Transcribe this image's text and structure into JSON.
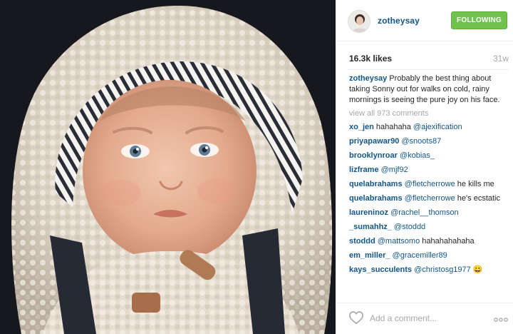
{
  "post": {
    "username": "zotheysay",
    "follow_label": "FOLLOWING",
    "likes": "16.3k likes",
    "time_ago": "31w",
    "caption_user": "zotheysay",
    "caption_text": " Probably the best thing about taking Sonny out for walks on cold, rainy mornings is seeing the pure joy on his face.",
    "view_all": "view all 973 comments",
    "add_comment_placeholder": "Add a comment...",
    "photo_alt_icon": "photo"
  },
  "comments": [
    {
      "user": "xo_jen",
      "text": " hahahaha ",
      "mention": "@ajexification",
      "tail": ""
    },
    {
      "user": "priyapawar90",
      "text": " ",
      "mention": "@snoots87",
      "tail": ""
    },
    {
      "user": "brooklynroar",
      "text": " ",
      "mention": "@kobias_",
      "tail": ""
    },
    {
      "user": "lizframe",
      "text": " ",
      "mention": "@mjf92",
      "tail": ""
    },
    {
      "user": "quelabrahams",
      "text": " ",
      "mention": "@fletcherrowe",
      "tail": " he kills me"
    },
    {
      "user": "quelabrahams",
      "text": " ",
      "mention": "@fletcherrowe",
      "tail": " he's ecstatic"
    },
    {
      "user": "laureninoz",
      "text": " ",
      "mention": "@rachel__thomson",
      "tail": ""
    },
    {
      "user": "_sumahhz_",
      "text": " ",
      "mention": "@stoddd",
      "tail": ""
    },
    {
      "user": "stoddd",
      "text": " ",
      "mention": "@mattsomo",
      "tail": " hahahahahaha"
    },
    {
      "user": "em_miller_",
      "text": " ",
      "mention": "@gracemiller89",
      "tail": ""
    },
    {
      "user": "kays_succulents",
      "text": " ",
      "mention": "@christosg1977",
      "tail": " 😀"
    }
  ],
  "colors": {
    "link": "#125688",
    "follow_bg": "#6fc24b",
    "muted": "#a5a7aa"
  },
  "icons": {
    "like": "heart-outline-icon",
    "more": "ellipsis-icon",
    "avatar": "avatar"
  }
}
